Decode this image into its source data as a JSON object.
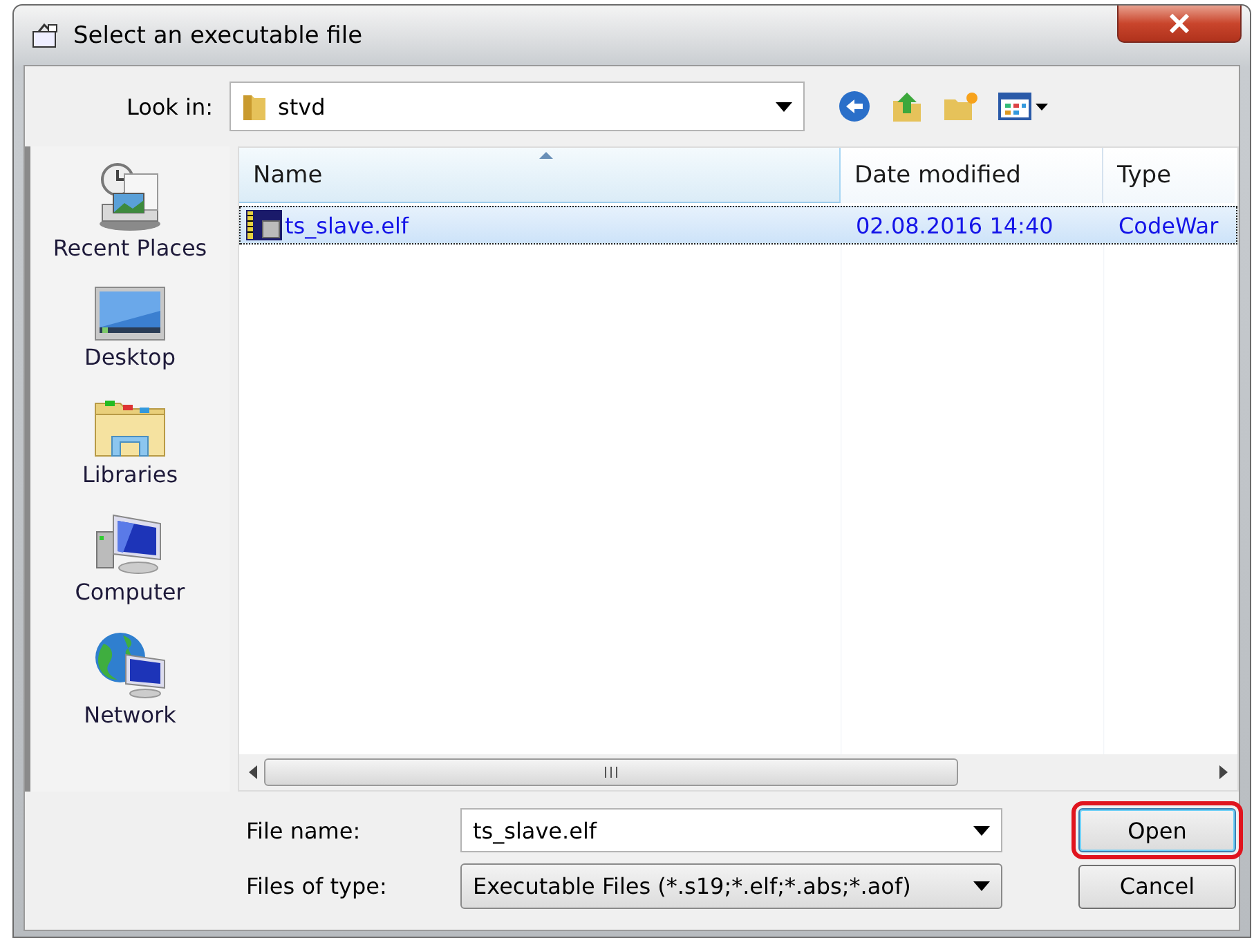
{
  "window": {
    "title": "Select an executable file"
  },
  "look_in": {
    "label": "Look in:",
    "value": "stvd"
  },
  "places": [
    {
      "kind": "recent",
      "label": "Recent Places"
    },
    {
      "kind": "desktop",
      "label": "Desktop"
    },
    {
      "kind": "libraries",
      "label": "Libraries"
    },
    {
      "kind": "computer",
      "label": "Computer"
    },
    {
      "kind": "network",
      "label": "Network"
    }
  ],
  "file_list": {
    "columns": [
      {
        "label": "Name",
        "sorted": true
      },
      {
        "label": "Date modified",
        "sorted": false
      },
      {
        "label": "Type",
        "sorted": false
      }
    ],
    "rows": [
      {
        "name": "ts_slave.elf",
        "date_modified": "02.08.2016 14:40",
        "type": "CodeWar",
        "selected": true
      }
    ]
  },
  "file_name": {
    "label": "File name:",
    "value": "ts_slave.elf"
  },
  "file_type": {
    "label": "Files of type:",
    "value": "Executable Files (*.s19;*.elf;*.abs;*.aof)"
  },
  "buttons": [
    {
      "label": "Open",
      "highlighted": true
    },
    {
      "label": "Cancel",
      "highlighted": false
    }
  ]
}
